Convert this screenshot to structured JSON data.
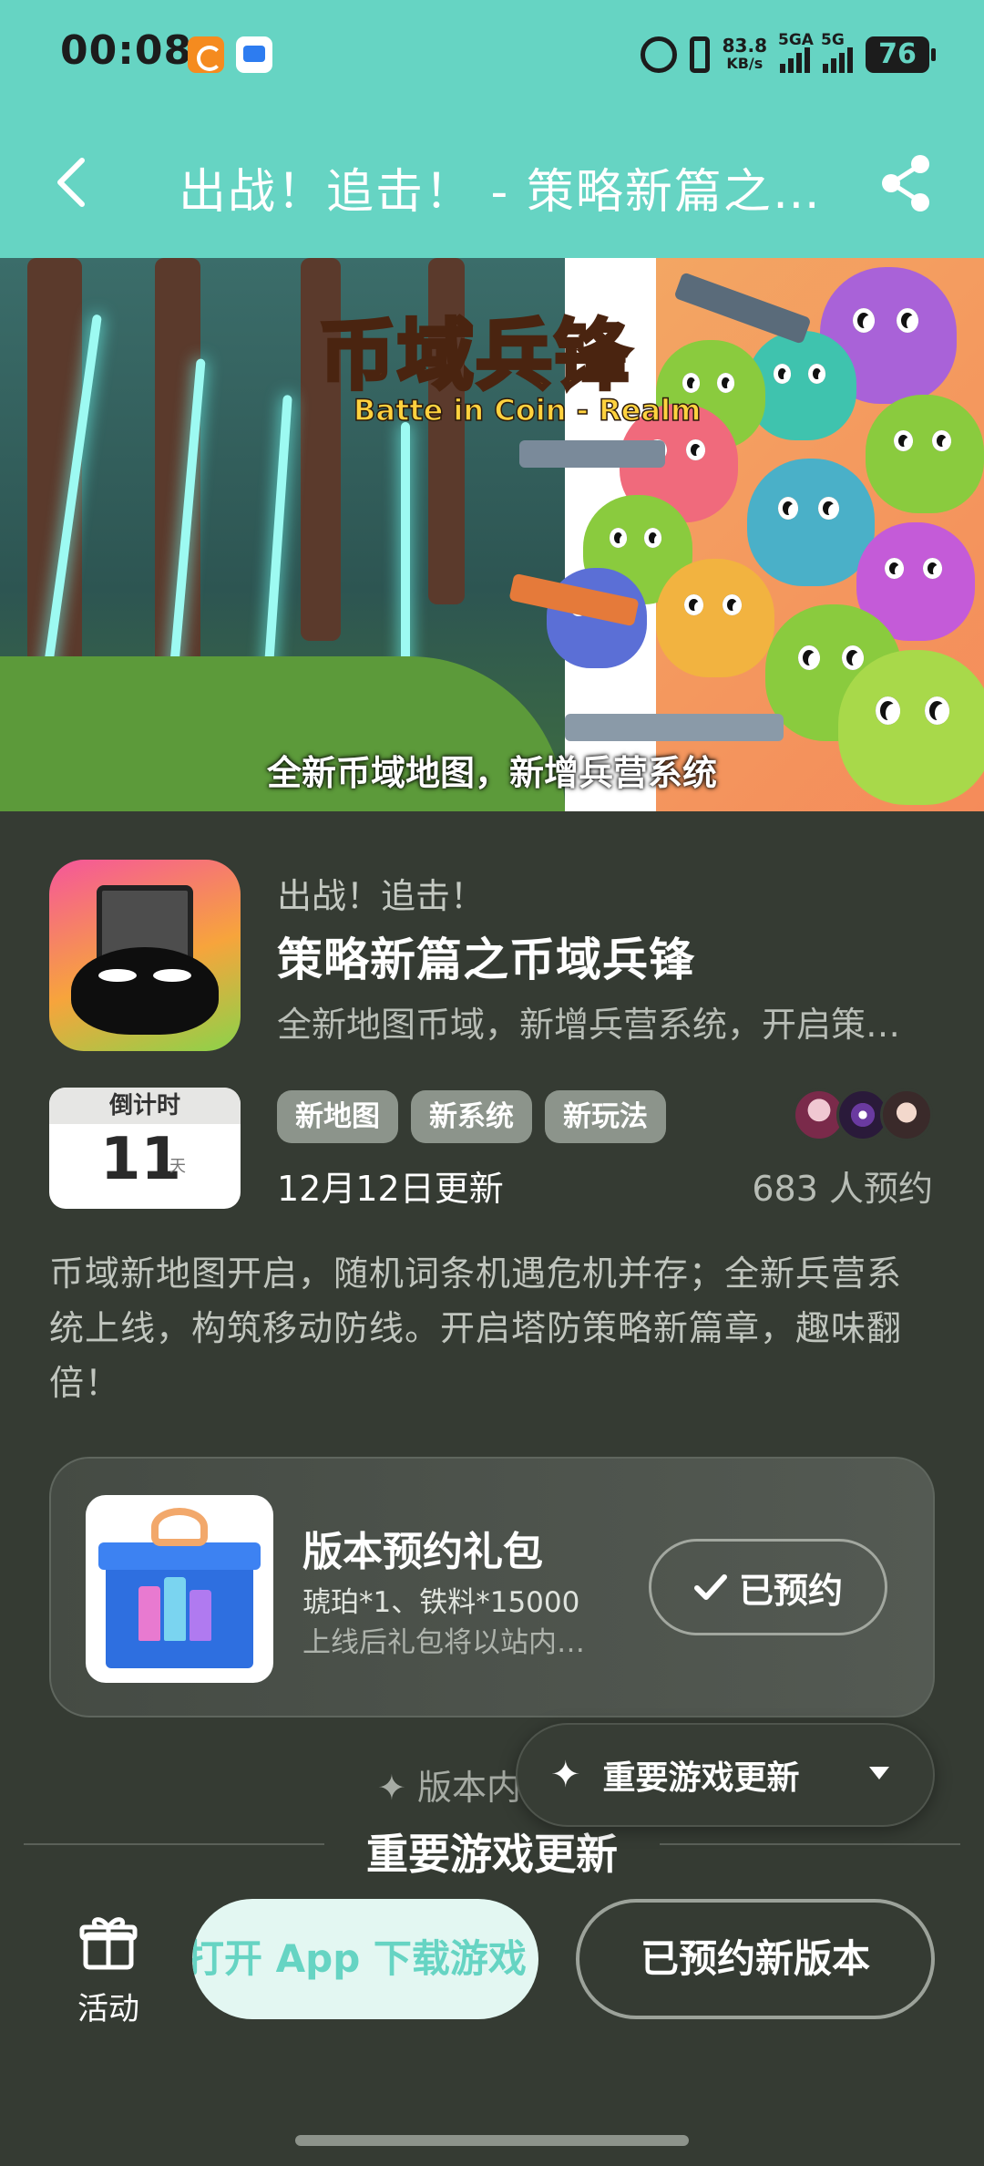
{
  "status_bar": {
    "time": "00:08",
    "speed_value": "83.8",
    "speed_unit": "KB/s",
    "sim1_label": "5GA",
    "sim2_label": "5G",
    "battery": "76"
  },
  "header": {
    "title": "出战！追击！ - 策略新篇之币域兵锋"
  },
  "banner": {
    "logo_title": "币域兵锋",
    "logo_subtitle": "Batte in Coin - Realm",
    "caption": "全新币域地图，新增兵营系统"
  },
  "app": {
    "subtitle": "出战！追击！",
    "name": "策略新篇之币域兵锋",
    "short_desc": "全新地图币域，新增兵营系统，开启策略新篇章",
    "countdown_label": "倒计时",
    "countdown_value": "11",
    "countdown_unit": "天",
    "tags": [
      "新地图",
      "新系统",
      "新玩法"
    ],
    "update_date": "12月12日更新",
    "reserve_count": "683 人预约",
    "long_desc": "币域新地图开启，随机词条机遇危机并存；全新兵营系统上线，构筑移动防线。开启塔防策略新篇章，趣味翻倍！"
  },
  "gift": {
    "title": "版本预约礼包",
    "items": "琥珀*1、铁料*15000",
    "note": "上线后礼包将以站内信形式发放",
    "button_label": "已预约"
  },
  "version": {
    "label": "版本内容",
    "float_selector": "重要游戏更新",
    "section_title": "重要游戏更新"
  },
  "bottom_bar": {
    "activity_label": "活动",
    "open_app_label": "打开 App 下载游戏",
    "reserved_version_label": "已预约新版本"
  },
  "colors": {
    "accent": "#66d4c3",
    "background": "#353b33"
  }
}
